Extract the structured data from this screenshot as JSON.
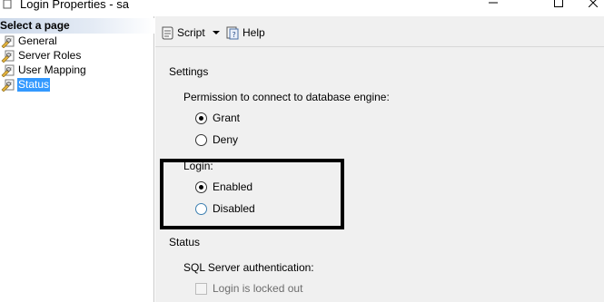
{
  "window": {
    "title": "Login Properties - sa"
  },
  "left_pane": {
    "header": "Select a page",
    "pages": [
      {
        "label": "General",
        "icon": "wrench-page-icon"
      },
      {
        "label": "Server Roles",
        "icon": "wrench-page-icon"
      },
      {
        "label": "User Mapping",
        "icon": "wrench-page-icon"
      },
      {
        "label": "Status",
        "icon": "wrench-page-icon",
        "selected": true
      }
    ]
  },
  "toolbar": {
    "script_label": "Script",
    "help_label": "Help"
  },
  "settings": {
    "section_title": "Settings",
    "permission_label": "Permission to connect to database engine:",
    "permission_options": [
      {
        "label": "Grant",
        "checked": true
      },
      {
        "label": "Deny",
        "checked": false
      }
    ],
    "login_label": "Login:",
    "login_options": [
      {
        "label": "Enabled",
        "checked": true
      },
      {
        "label": "Disabled",
        "checked": false
      }
    ]
  },
  "status": {
    "section_title": "Status",
    "sql_auth_label": "SQL Server authentication:",
    "locked_out_label": "Login is locked out",
    "locked_out_checked": false
  },
  "colors": {
    "selection": "#3399ff",
    "pane_background": "#f0f0f0",
    "header_gradient_start": "#cdd9ea",
    "highlight_box": "#000000"
  }
}
